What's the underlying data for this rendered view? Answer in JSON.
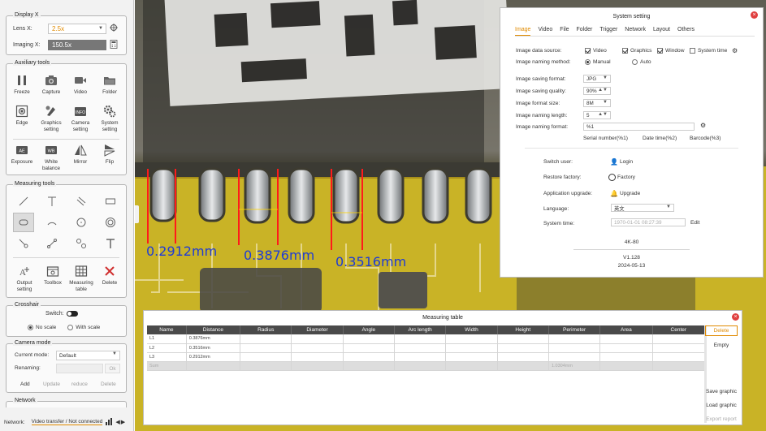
{
  "display": {
    "title": "Display X",
    "lens_label": "Lens X:",
    "lens_value": "2.5x",
    "imaging_label": "Imaging X:",
    "imaging_value": "150.5x"
  },
  "auxiliary": {
    "title": "Auxiliary tools",
    "tools": [
      {
        "label": "Freeze",
        "icon": "pause-icon"
      },
      {
        "label": "Capture",
        "icon": "camera-icon"
      },
      {
        "label": "Video",
        "icon": "video-icon"
      },
      {
        "label": "Folder",
        "icon": "folder-icon"
      },
      {
        "label": "Edge",
        "icon": "edge-icon"
      },
      {
        "label": "Graphics setting",
        "icon": "palette-icon"
      },
      {
        "label": "Camera setting",
        "icon": "info-camera-icon"
      },
      {
        "label": "System setting",
        "icon": "gear-icon"
      },
      {
        "label": "Exposure",
        "icon": "exposure-icon"
      },
      {
        "label": "White balance",
        "icon": "wb-icon"
      },
      {
        "label": "Mirror",
        "icon": "mirror-icon"
      },
      {
        "label": "Flip",
        "icon": "flip-icon"
      }
    ]
  },
  "measuring": {
    "title": "Measuring tools",
    "bottom": [
      {
        "label": "Output setting",
        "icon": "output-icon"
      },
      {
        "label": "Toolbox",
        "icon": "toolbox-icon"
      },
      {
        "label": "Measuring table",
        "icon": "table-icon"
      },
      {
        "label": "Delete",
        "icon": "delete-icon"
      }
    ]
  },
  "crosshair": {
    "title": "Crosshair",
    "switch_label": "Switch:",
    "no_scale": "No scale",
    "with_scale": "With scale"
  },
  "camera_mode": {
    "title": "Camera mode",
    "current_label": "Current mode:",
    "current_value": "Default",
    "renaming_label": "Renaming:",
    "ok": "Ok",
    "add": "Add",
    "update": "Update",
    "reduce": "reduce",
    "delete": "Delete"
  },
  "network": {
    "title": "Network",
    "status_label": "Network:",
    "status_value": "Video transfer / Not connected"
  },
  "measurements": [
    "0.2912mm",
    "0.3876mm",
    "0.3516mm"
  ],
  "system": {
    "title": "System setting",
    "tabs": [
      "Image",
      "Video",
      "File",
      "Folder",
      "Trigger",
      "Network",
      "Layout",
      "Others"
    ],
    "source_label": "Image data source:",
    "source_video": "Video",
    "source_graphics": "Graphics",
    "source_window": "Window",
    "source_systime": "System time",
    "naming_method_label": "Image naming method:",
    "naming_manual": "Manual",
    "naming_auto": "Auto",
    "saving_format_label": "Image saving format:",
    "saving_format_value": "JPG",
    "saving_quality_label": "Image saving quality:",
    "saving_quality_value": "90%",
    "format_size_label": "Image format size:",
    "format_size_value": "8M",
    "naming_length_label": "Image naming length:",
    "naming_length_value": "5",
    "naming_format_label": "Image naming format:",
    "naming_format_value": "%1",
    "serial": "Serial number(%1)",
    "datetime": "Date time(%2)",
    "barcode": "Barcode(%3)",
    "switch_user_label": "Switch user:",
    "login": "Login",
    "restore_label": "Restore factory:",
    "factory": "Factory",
    "upgrade_label": "Application upgrade:",
    "upgrade": "Upgrade",
    "language_label": "Language:",
    "language_value": "英文",
    "systime_label": "System time:",
    "systime_value": "1970-01-01 08:27:39",
    "edit": "Edit",
    "model": "4K-80",
    "version": "V1.128",
    "date": "2024-05-13"
  },
  "table": {
    "title": "Measuring table",
    "headers": [
      "Name",
      "Distance",
      "Radius",
      "Diameter",
      "Angle",
      "Arc length",
      "Width",
      "Height",
      "Perimeter",
      "Area",
      "Center"
    ],
    "rows": [
      {
        "name": "L1",
        "distance": "0.3876mm",
        "perimeter": ""
      },
      {
        "name": "L2",
        "distance": "0.3516mm",
        "perimeter": ""
      },
      {
        "name": "L3",
        "distance": "0.2912mm",
        "perimeter": ""
      },
      {
        "name": "Sum",
        "distance": "",
        "perimeter": "1.0304mm"
      }
    ],
    "side": {
      "delete": "Delete",
      "empty": "Empty",
      "save": "Save graphic",
      "load": "Load graphic",
      "export": "Export report"
    }
  }
}
